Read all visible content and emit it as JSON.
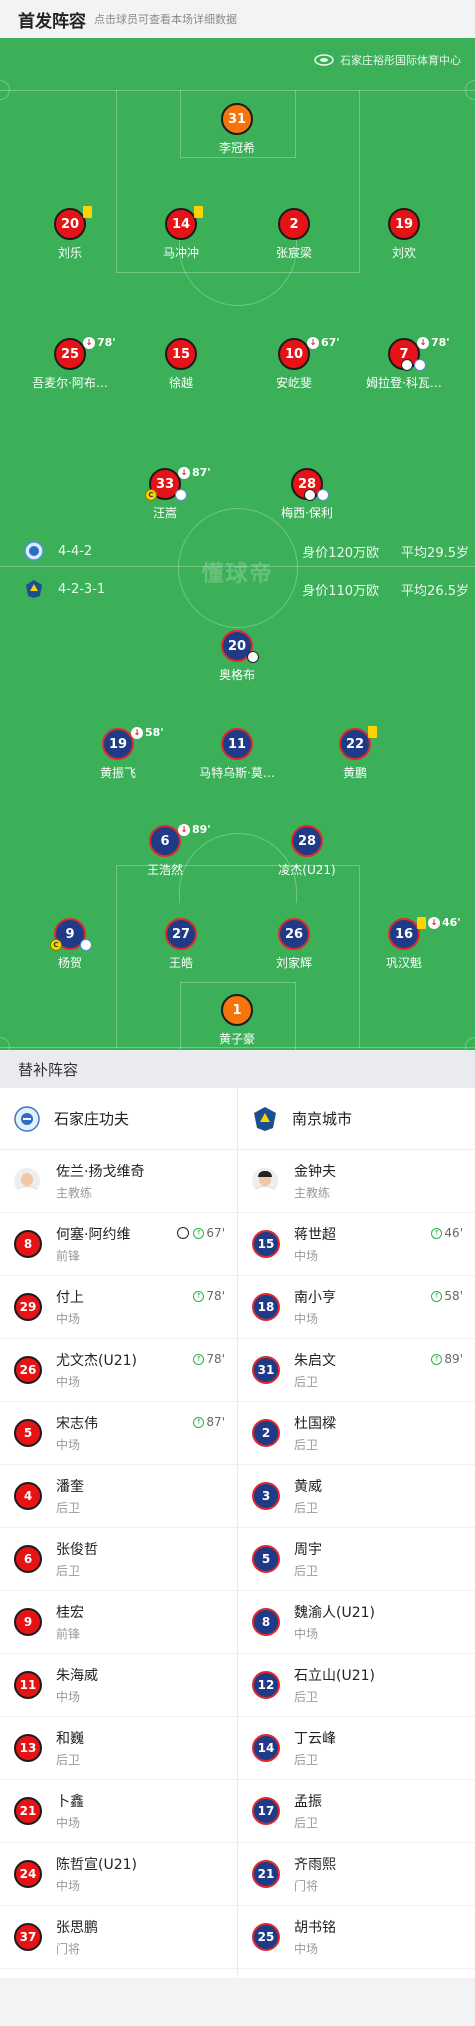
{
  "header": {
    "title": "首发阵容",
    "subtitle": "点击球员可查看本场详细数据"
  },
  "venue": "石家庄裕彤国际体育中心",
  "watermark": "懂球帝",
  "home": {
    "formation": "4-4-2",
    "value": "身价120万欧",
    "age": "平均29.5岁"
  },
  "away": {
    "formation": "4-2-3-1",
    "value": "身价110万欧",
    "age": "平均26.5岁"
  },
  "lineup": {
    "home": [
      {
        "num": "31",
        "name": "李冠希",
        "color": "orange"
      },
      {
        "num": "20",
        "name": "刘乐",
        "yellow": true
      },
      {
        "num": "14",
        "name": "马冲冲",
        "yellow": true
      },
      {
        "num": "2",
        "name": "张宸梁"
      },
      {
        "num": "19",
        "name": "刘欢"
      },
      {
        "num": "25",
        "name": "吾麦尔·阿布…",
        "sub": "78'"
      },
      {
        "num": "15",
        "name": "徐越"
      },
      {
        "num": "10",
        "name": "安屹斐",
        "sub": "67'"
      },
      {
        "num": "7",
        "name": "姆拉登·科瓦…",
        "sub": "78'",
        "balls": [
          "goal",
          "assist"
        ]
      },
      {
        "num": "33",
        "name": "汪嵩",
        "sub": "87'",
        "captain": true,
        "balls": [
          "assist"
        ]
      },
      {
        "num": "28",
        "name": "梅西·保利",
        "balls": [
          "goal",
          "assist"
        ]
      }
    ],
    "away": [
      {
        "num": "20",
        "name": "奥格布",
        "balls": [
          "goal"
        ]
      },
      {
        "num": "19",
        "name": "黄振飞",
        "sub": "58'"
      },
      {
        "num": "11",
        "name": "马特乌斯·莫…"
      },
      {
        "num": "22",
        "name": "黄鹏",
        "yellow": true
      },
      {
        "num": "6",
        "name": "王浩然",
        "sub": "89'"
      },
      {
        "num": "28",
        "name": "凌杰(U21)"
      },
      {
        "num": "9",
        "name": "杨贺",
        "captain": true,
        "balls": [
          "assist"
        ]
      },
      {
        "num": "27",
        "name": "王皓"
      },
      {
        "num": "26",
        "name": "刘家辉"
      },
      {
        "num": "16",
        "name": "巩汉魁",
        "yellow": true,
        "sub": "46'"
      },
      {
        "num": "1",
        "name": "黄子豪",
        "color": "orange"
      }
    ]
  },
  "subs_title": "替补阵容",
  "subs": {
    "home": {
      "team": "石家庄功夫",
      "coach": {
        "name": "佐兰·扬戈维奇",
        "role": "主教练"
      },
      "players": [
        {
          "num": "8",
          "name": "何塞·阿约维",
          "pos": "前锋",
          "goal": true,
          "in": "67'"
        },
        {
          "num": "29",
          "name": "付上",
          "pos": "中场",
          "in": "78'"
        },
        {
          "num": "26",
          "name": "尤文杰(U21)",
          "pos": "中场",
          "in": "78'"
        },
        {
          "num": "5",
          "name": "宋志伟",
          "pos": "中场",
          "in": "87'"
        },
        {
          "num": "4",
          "name": "潘奎",
          "pos": "后卫"
        },
        {
          "num": "6",
          "name": "张俊哲",
          "pos": "后卫"
        },
        {
          "num": "9",
          "name": "桂宏",
          "pos": "前锋"
        },
        {
          "num": "11",
          "name": "朱海威",
          "pos": "中场"
        },
        {
          "num": "13",
          "name": "和巍",
          "pos": "后卫"
        },
        {
          "num": "21",
          "name": "卜鑫",
          "pos": "中场"
        },
        {
          "num": "24",
          "name": "陈哲宣(U21)",
          "pos": "中场"
        },
        {
          "num": "37",
          "name": "张思鹏",
          "pos": "门将"
        }
      ]
    },
    "away": {
      "team": "南京城市",
      "coach": {
        "name": "金钟夫",
        "role": "主教练"
      },
      "players": [
        {
          "num": "15",
          "name": "蒋世超",
          "pos": "中场",
          "in": "46'"
        },
        {
          "num": "18",
          "name": "南小亨",
          "pos": "中场",
          "in": "58'"
        },
        {
          "num": "31",
          "name": "朱启文",
          "pos": "后卫",
          "in": "89'"
        },
        {
          "num": "2",
          "name": "杜国樑",
          "pos": "后卫"
        },
        {
          "num": "3",
          "name": "黄威",
          "pos": "后卫"
        },
        {
          "num": "5",
          "name": "周宇",
          "pos": "后卫"
        },
        {
          "num": "8",
          "name": "魏渝人(U21)",
          "pos": "中场"
        },
        {
          "num": "12",
          "name": "石立山(U21)",
          "pos": "后卫"
        },
        {
          "num": "14",
          "name": "丁云峰",
          "pos": "后卫"
        },
        {
          "num": "17",
          "name": "孟振",
          "pos": "后卫"
        },
        {
          "num": "21",
          "name": "齐雨熙",
          "pos": "门将"
        },
        {
          "num": "25",
          "name": "胡书铭",
          "pos": "中场"
        }
      ]
    }
  }
}
